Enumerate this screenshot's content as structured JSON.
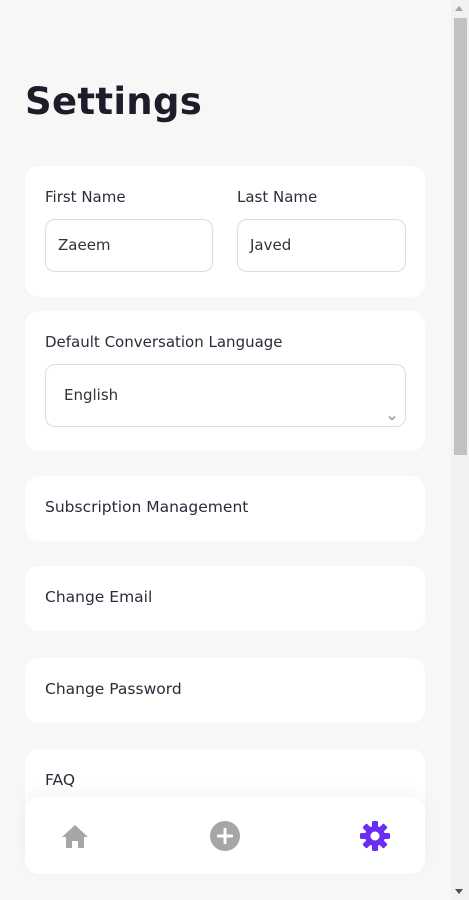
{
  "page": {
    "title": "Settings"
  },
  "profile": {
    "first_name_label": "First Name",
    "first_name_value": "Zaeem",
    "last_name_label": "Last Name",
    "last_name_value": "Javed"
  },
  "language": {
    "label": "Default Conversation Language",
    "selected": "English"
  },
  "menu": {
    "subscription": "Subscription Management",
    "change_email": "Change Email",
    "change_password": "Change Password",
    "faq": "FAQ"
  },
  "nav": {
    "items": [
      {
        "icon": "home-icon",
        "active": false
      },
      {
        "icon": "add-circle-icon",
        "active": false
      },
      {
        "icon": "gear-icon",
        "active": true
      }
    ],
    "colors": {
      "inactive": "#a6a6a6",
      "active": "#6b2cf5"
    }
  }
}
